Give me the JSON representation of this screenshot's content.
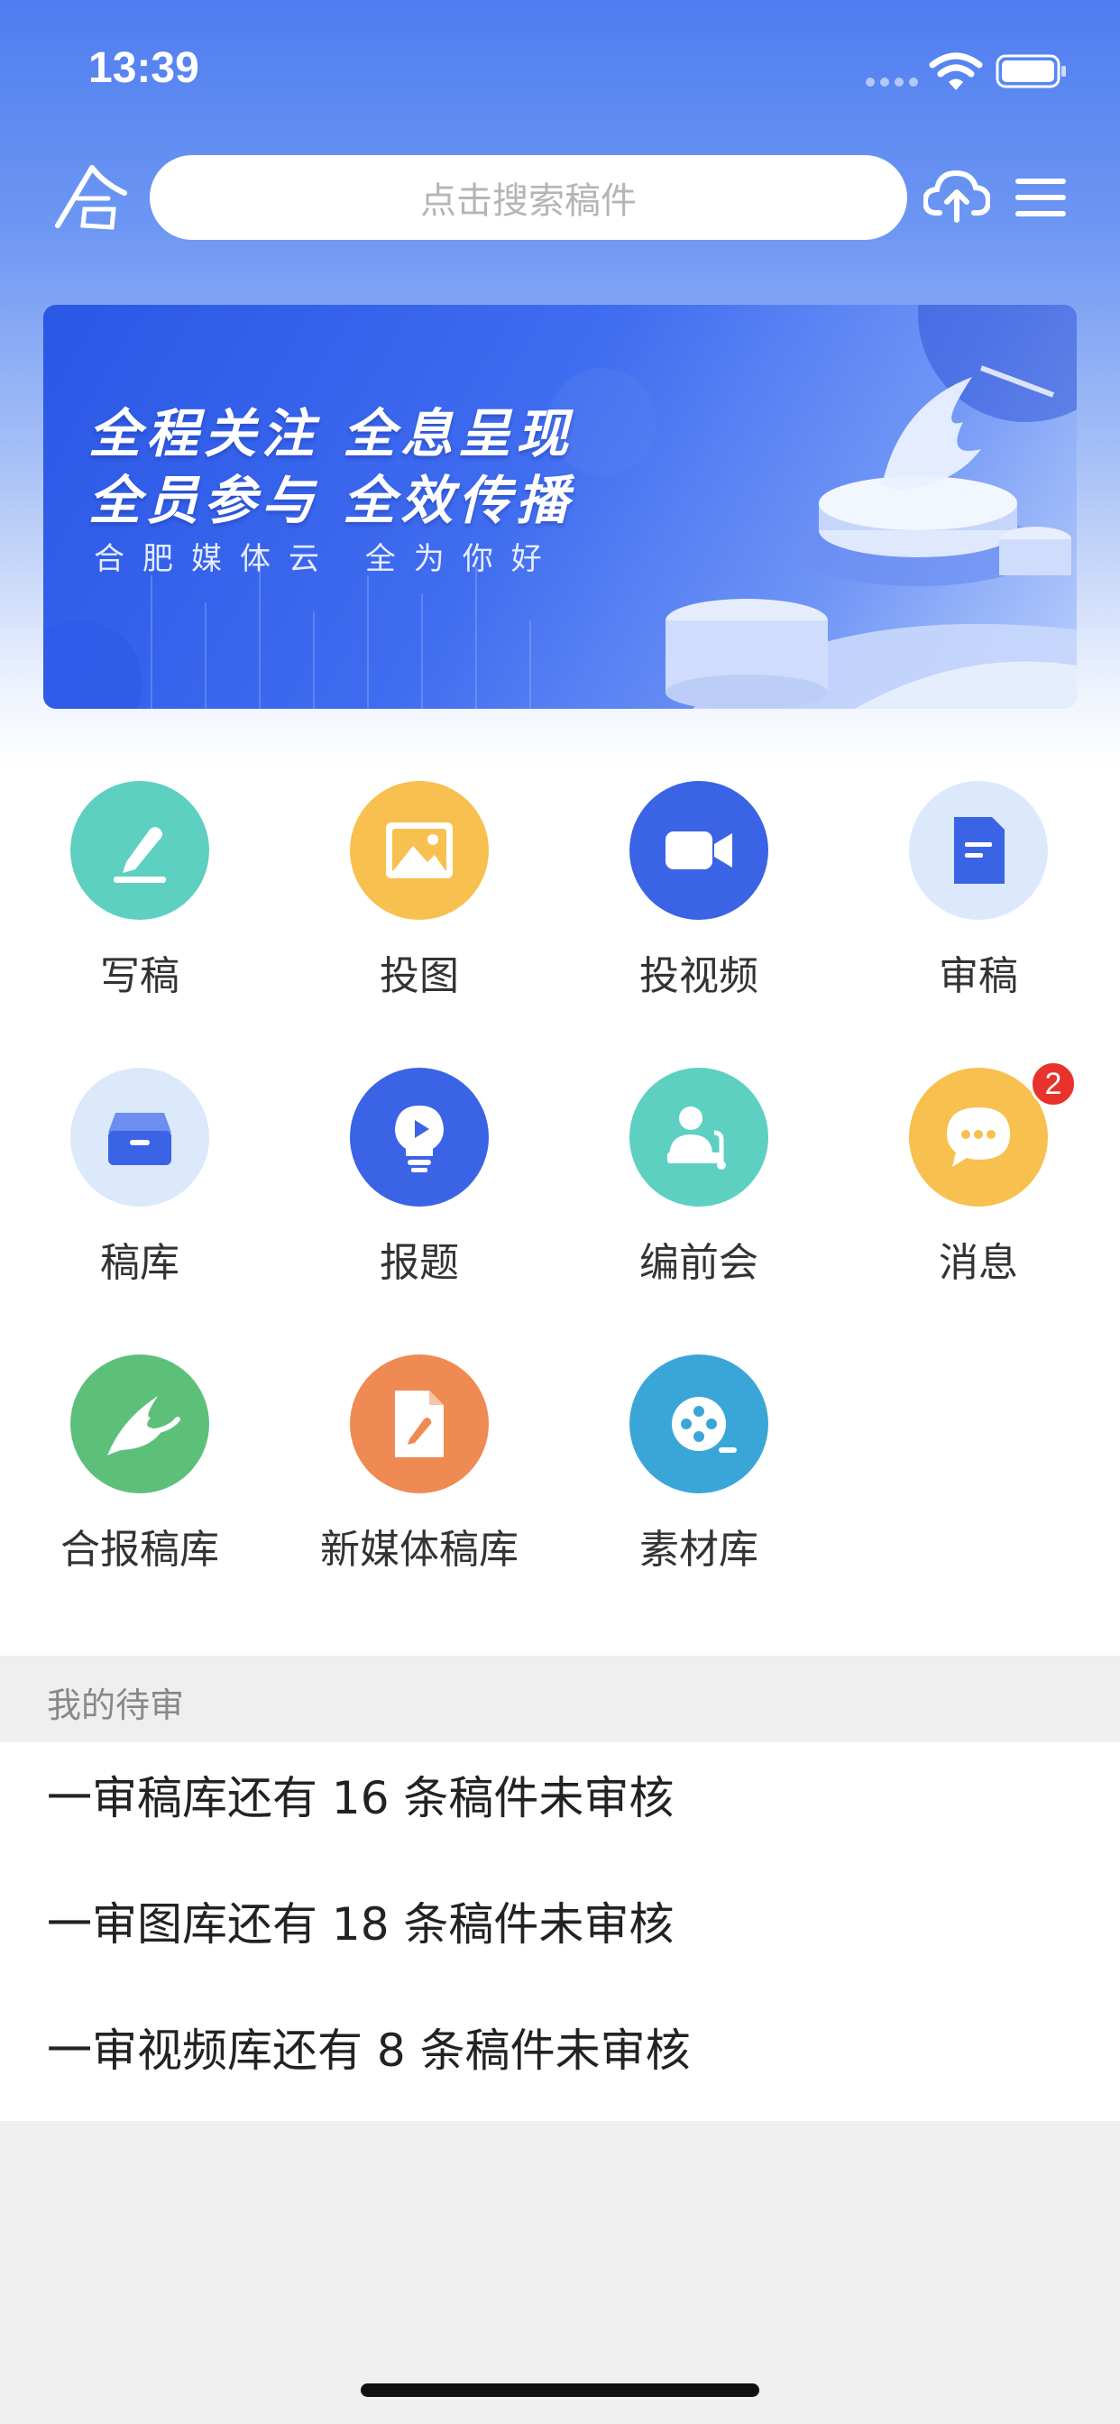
{
  "status_bar": {
    "time": "13:39"
  },
  "search": {
    "placeholder": "点击搜索稿件"
  },
  "banner": {
    "line1": "全程关注  全息呈现",
    "line2": "全员参与  全效传播",
    "subtitle": "合肥媒体云  全为你好"
  },
  "grid": {
    "items": [
      {
        "label": "写稿",
        "icon": "pen-icon",
        "color": "#5dd0c1"
      },
      {
        "label": "投图",
        "icon": "image-icon",
        "color": "#f7c04f"
      },
      {
        "label": "投视频",
        "icon": "video-camera-icon",
        "color": "#3b63e6"
      },
      {
        "label": "审稿",
        "icon": "document-icon",
        "color": "#dbe9fb"
      },
      {
        "label": "稿库",
        "icon": "inbox-tray-icon",
        "color": "#dbe9fb"
      },
      {
        "label": "报题",
        "icon": "lightbulb-play-icon",
        "color": "#3b63e6"
      },
      {
        "label": "编前会",
        "icon": "presenter-icon",
        "color": "#5dd0c1"
      },
      {
        "label": "消息",
        "icon": "chat-bubble-icon",
        "color": "#f7c04f"
      },
      {
        "label": "合报稿库",
        "icon": "hebao-logo-icon",
        "color": "#5cc07a"
      },
      {
        "label": "新媒体稿库",
        "icon": "file-edit-icon",
        "color": "#ef8a53"
      },
      {
        "label": "素材库",
        "icon": "film-reel-icon",
        "color": "#3aa6d8"
      }
    ],
    "message_badge": "2"
  },
  "pending": {
    "header": "我的待审",
    "items": [
      "一审稿库还有 16 条稿件未审核",
      "一审图库还有 18 条稿件未审核",
      "一审视频库还有 8 条稿件未审核"
    ]
  }
}
